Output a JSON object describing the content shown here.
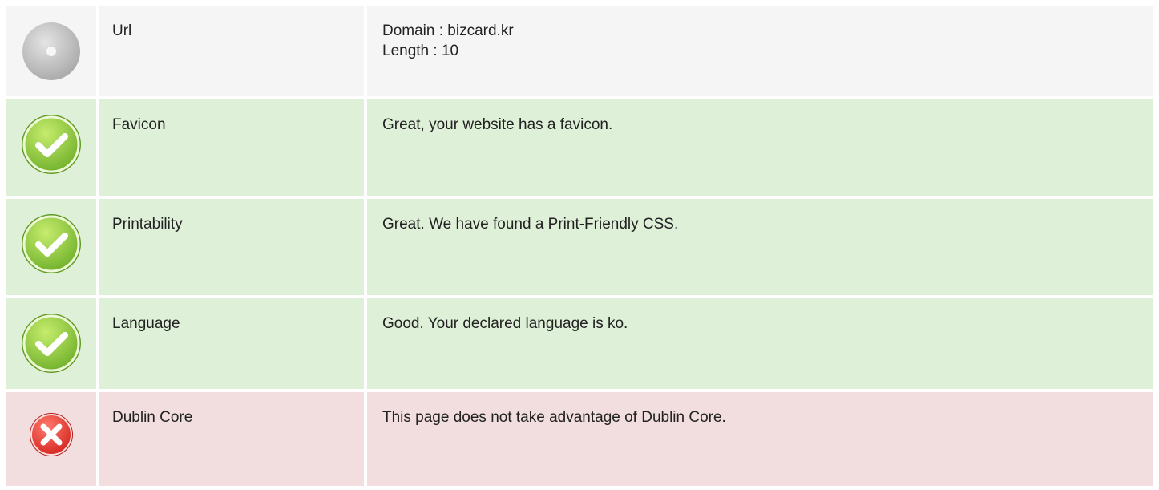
{
  "rows": [
    {
      "status": "neutral",
      "icon": "info-disc-icon",
      "label": "Url",
      "value_lines": [
        "Domain : bizcard.kr",
        "Length : 10"
      ]
    },
    {
      "status": "pass",
      "icon": "check-circle-icon",
      "label": "Favicon",
      "value_lines": [
        "Great, your website has a favicon."
      ]
    },
    {
      "status": "pass",
      "icon": "check-circle-icon",
      "label": "Printability",
      "value_lines": [
        "Great. We have found a Print-Friendly CSS."
      ]
    },
    {
      "status": "pass",
      "icon": "check-circle-icon",
      "label": "Language",
      "value_lines": [
        "Good. Your declared language is ko."
      ]
    },
    {
      "status": "fail",
      "icon": "cross-circle-icon",
      "label": "Dublin Core",
      "value_lines": [
        "This page does not take advantage of Dublin Core."
      ]
    }
  ],
  "colors": {
    "neutral_bg": "#f5f5f5",
    "pass_bg": "#dff0d8",
    "fail_bg": "#f2dede",
    "pass_icon": "#8cc63f",
    "fail_icon": "#e53935"
  }
}
